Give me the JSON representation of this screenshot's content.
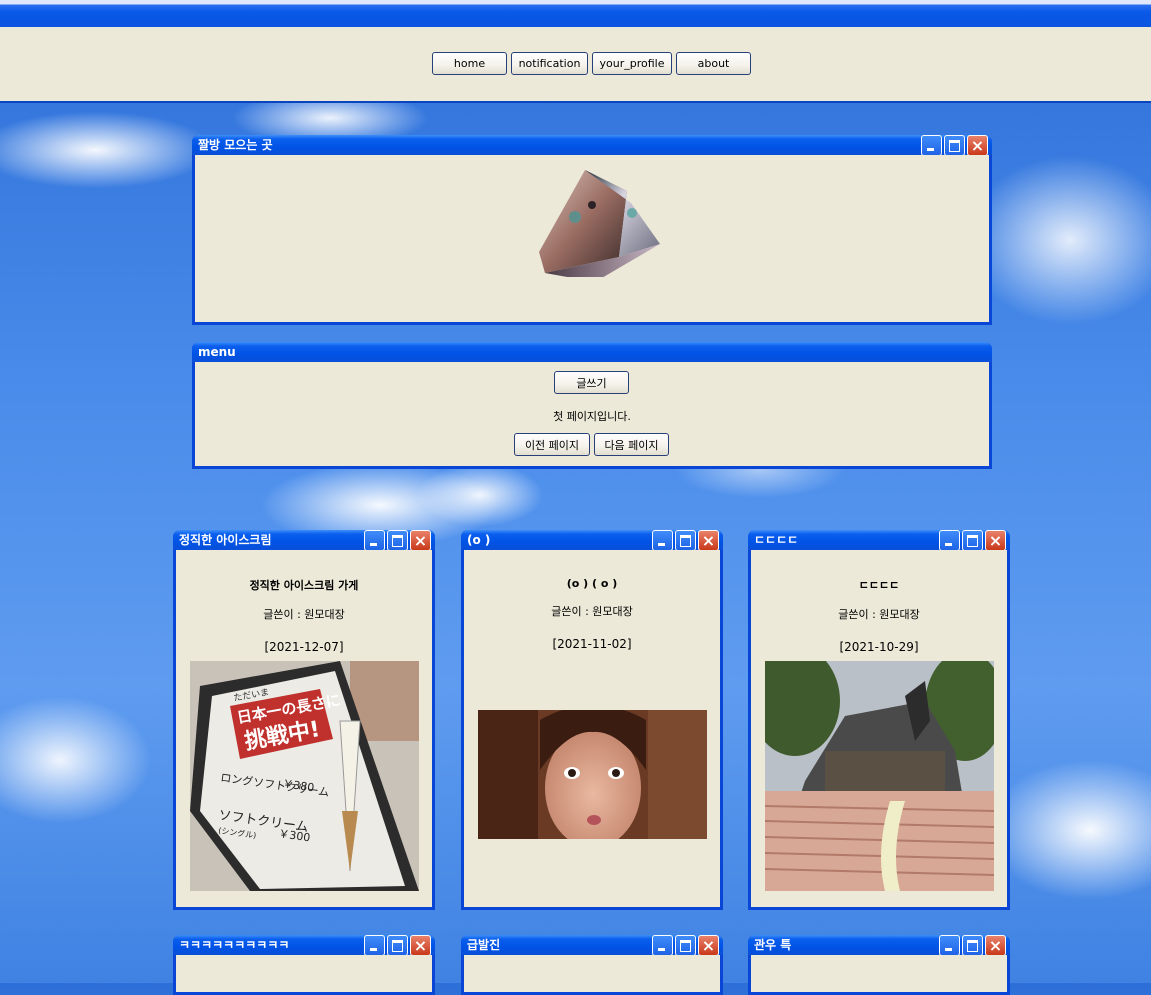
{
  "nav": {
    "buttons": [
      "home",
      "notification",
      "your_profile",
      "about"
    ]
  },
  "main_window": {
    "title": "짤방 모으는 곳"
  },
  "menu_window": {
    "title": "menu",
    "write_label": "글쓰기",
    "status_text": "첫 페이지입니다.",
    "prev_label": "이전 페이지",
    "next_label": "다음 페이지"
  },
  "posts": [
    {
      "window_title": "정직한 아이스크림",
      "heading": "정직한 아이스크림 가게",
      "author": "글쓴이 : 원모대장",
      "date": "[2021-12-07]"
    },
    {
      "window_title": "(o )",
      "heading": "(o ) ( o )",
      "author": "글쓴이 : 원모대장",
      "date": "[2021-11-02]"
    },
    {
      "window_title": "ㄷㄷㄷㄷ",
      "heading": "ㄷㄷㄷㄷ",
      "author": "글쓴이 : 원모대장",
      "date": "[2021-10-29]"
    }
  ],
  "sign_texts": {
    "line1": "ただいま",
    "line2": "日本一の長さに",
    "line3": "挑戦中!",
    "item1": "ロングソフトクリーム",
    "price1": "￥380",
    "item2": "ソフトクリーム",
    "item2_sub": "(シングル)",
    "price2": "￥300"
  },
  "bottom_windows": [
    {
      "title": "ㅋㅋㅋㅋㅋㅋㅋㅋㅋㅋ"
    },
    {
      "title": "급발진"
    },
    {
      "title": "관우 특"
    }
  ],
  "colors": {
    "titlebar": "#0053e6",
    "window_bg": "#ece9d8",
    "close_button": "#c9381a"
  }
}
